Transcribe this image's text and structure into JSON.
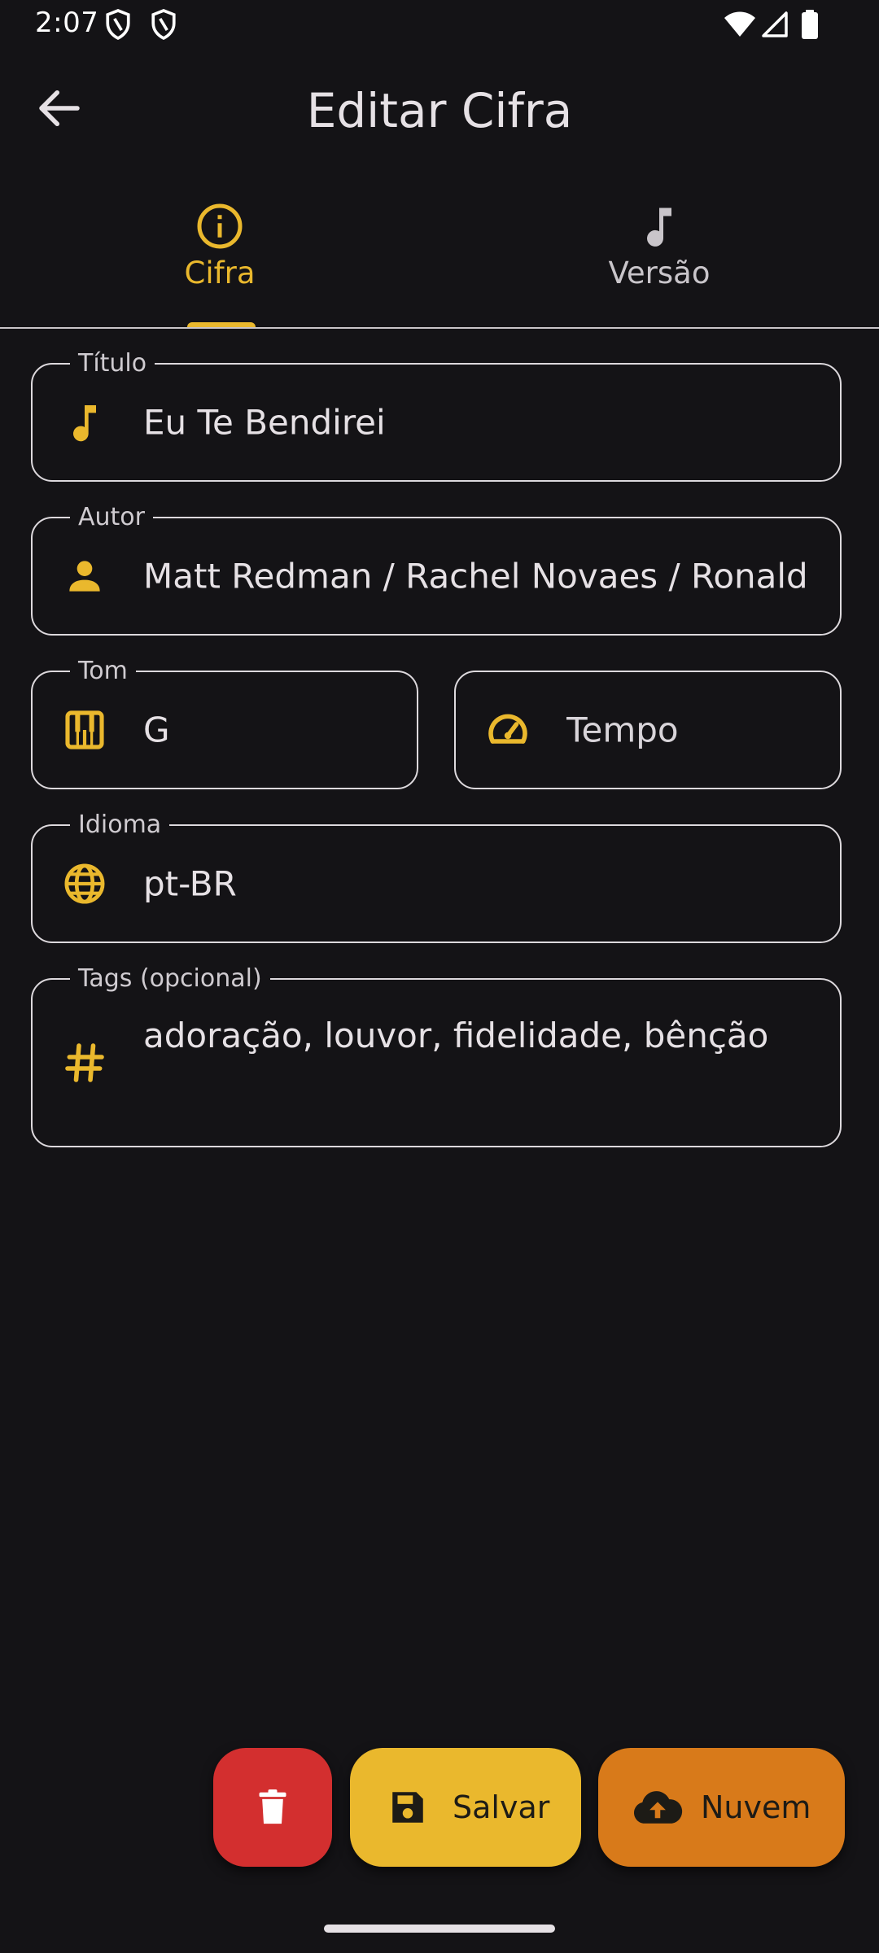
{
  "status_bar": {
    "time": "2:07"
  },
  "app_bar": {
    "title": "Editar Cifra"
  },
  "tabs": [
    {
      "label": "Cifra",
      "icon": "info-icon",
      "active": true
    },
    {
      "label": "Versão",
      "icon": "music-note-icon",
      "active": false
    }
  ],
  "form": {
    "titulo": {
      "label": "Título",
      "value": "Eu Te Bendirei",
      "icon": "music-note-icon"
    },
    "autor": {
      "label": "Autor",
      "value": "Matt Redman / Rachel Novaes / Ronald",
      "icon": "person-icon"
    },
    "tom": {
      "label": "Tom",
      "value": "G",
      "icon": "piano-icon"
    },
    "tempo": {
      "placeholder": "Tempo",
      "icon": "speedometer-icon"
    },
    "idioma": {
      "label": "Idioma",
      "value": "pt-BR",
      "icon": "globe-icon"
    },
    "tags": {
      "label": "Tags (opcional)",
      "value": "adoração, louvor, fidelidade, bênção",
      "icon": "hash-icon"
    }
  },
  "actions": {
    "delete": {
      "icon": "trash-icon",
      "color": "#d32f2f"
    },
    "save": {
      "label": "Salvar",
      "icon": "save-icon",
      "color": "#eab82d"
    },
    "cloud": {
      "label": "Nuvem",
      "icon": "cloud-upload-icon",
      "color": "#d87a1a"
    }
  },
  "colors": {
    "accent": "#eab82d",
    "background": "#141316",
    "delete": "#d32f2f",
    "cloud": "#d87a1a"
  }
}
